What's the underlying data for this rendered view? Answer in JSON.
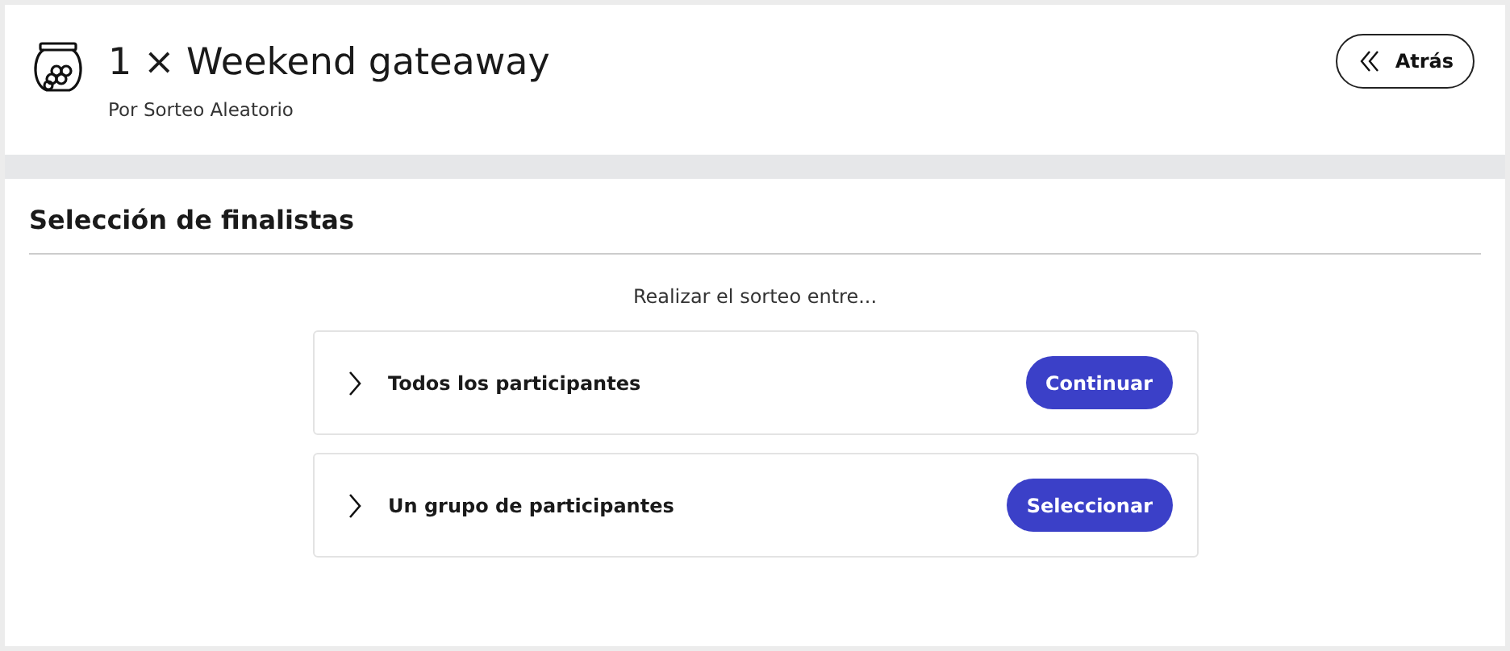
{
  "header": {
    "title": "1 × Weekend gateaway",
    "subtitle": "Por Sorteo Aleatorio",
    "back_button": "Atrás"
  },
  "section": {
    "title": "Selección de finalistas",
    "prompt": "Realizar el sorteo entre...",
    "options": [
      {
        "label": "Todos los participantes",
        "expanded": false,
        "action": "Continuar"
      },
      {
        "label": "Un grupo de participantes",
        "expanded": false,
        "action": "Seleccionar"
      }
    ]
  }
}
